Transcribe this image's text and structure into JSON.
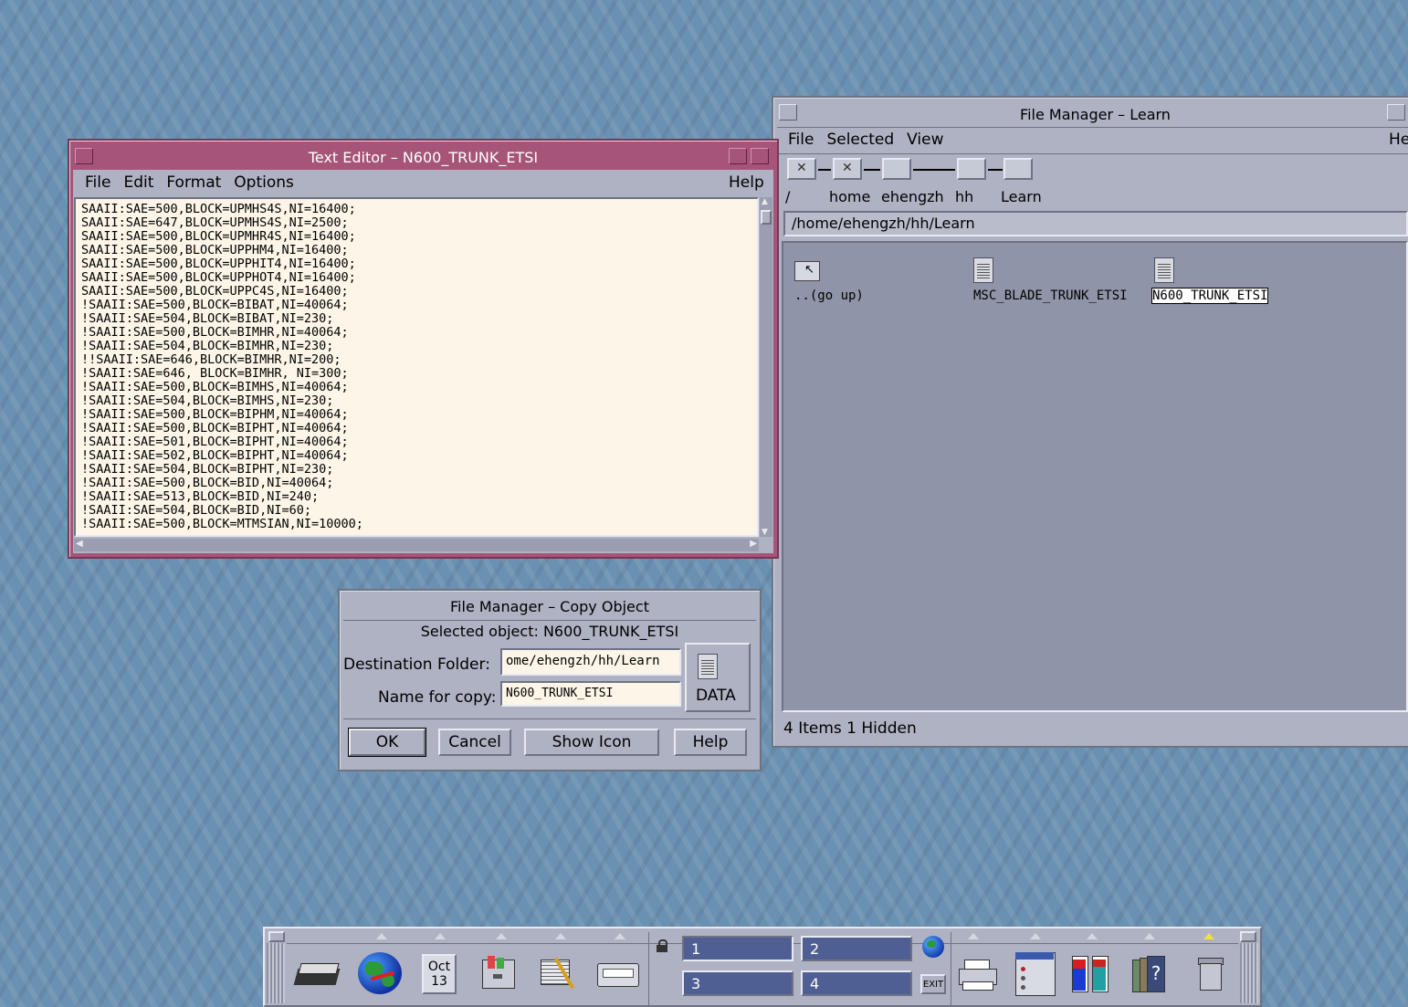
{
  "text_editor": {
    "title": "Text Editor – N600_TRUNK_ETSI",
    "menu": {
      "file": "File",
      "edit": "Edit",
      "format": "Format",
      "options": "Options",
      "help": "Help"
    },
    "lines": [
      "SAAII:SAE=500,BLOCK=UPMHS4S,NI=16400;",
      "SAAII:SAE=647,BLOCK=UPMHS4S,NI=2500;",
      "SAAII:SAE=500,BLOCK=UPMHR4S,NI=16400;",
      "SAAII:SAE=500,BLOCK=UPPHM4,NI=16400;",
      "SAAII:SAE=500,BLOCK=UPPHIT4,NI=16400;",
      "SAAII:SAE=500,BLOCK=UPPHOT4,NI=16400;",
      "SAAII:SAE=500,BLOCK=UPPC4S,NI=16400;",
      "!SAAII:SAE=500,BLOCK=BIBAT,NI=40064;",
      "!SAAII:SAE=504,BLOCK=BIBAT,NI=230;",
      "!SAAII:SAE=500,BLOCK=BIMHR,NI=40064;",
      "!SAAII:SAE=504,BLOCK=BIMHR,NI=230;",
      "!!SAAII:SAE=646,BLOCK=BIMHR,NI=200;",
      "!SAAII:SAE=646, BLOCK=BIMHR, NI=300;",
      "!SAAII:SAE=500,BLOCK=BIMHS,NI=40064;",
      "!SAAII:SAE=504,BLOCK=BIMHS,NI=230;",
      "!SAAII:SAE=500,BLOCK=BIPHM,NI=40064;",
      "!SAAII:SAE=500,BLOCK=BIPHT,NI=40064;",
      "!SAAII:SAE=501,BLOCK=BIPHT,NI=40064;",
      "!SAAII:SAE=502,BLOCK=BIPHT,NI=40064;",
      "!SAAII:SAE=504,BLOCK=BIPHT,NI=230;",
      "!SAAII:SAE=500,BLOCK=BID,NI=40064;",
      "!SAAII:SAE=513,BLOCK=BID,NI=240;",
      "!SAAII:SAE=504,BLOCK=BID,NI=60;",
      "!SAAII:SAE=500,BLOCK=MTMSIAN,NI=10000;"
    ]
  },
  "file_manager": {
    "title": "File Manager – Learn",
    "menu": {
      "file": "File",
      "selected": "Selected",
      "view": "View",
      "help": "He"
    },
    "crumbs": {
      "root": "/",
      "home": "home",
      "user": "ehengzh",
      "hh": "hh",
      "learn": "Learn"
    },
    "path": "/home/ehengzh/hh/Learn",
    "items": [
      {
        "label": "..(go up)",
        "icon": "folder-up-icon"
      },
      {
        "label": "MSC_BLADE_TRUNK_ETSI",
        "icon": "data-file-icon"
      },
      {
        "label": "N600_TRUNK_ETSI",
        "icon": "data-file-icon"
      }
    ],
    "status": "4 Items 1 Hidden"
  },
  "copy_dialog": {
    "title": "File Manager – Copy Object",
    "selected": "Selected object: N600_TRUNK_ETSI",
    "dest_label": "Destination Folder:",
    "dest_value": "ome/ehengzh/hh/Learn",
    "name_label": "Name for copy:",
    "name_value": "N600_TRUNK_ETSI",
    "icon_label": "DATA",
    "buttons": {
      "ok": "OK",
      "cancel": "Cancel",
      "show_icon": "Show Icon",
      "help": "Help"
    }
  },
  "front_panel": {
    "date": {
      "month": "Oct",
      "day": "13"
    },
    "workspaces": [
      "1",
      "2",
      "3",
      "4"
    ],
    "exit": "EXIT"
  }
}
